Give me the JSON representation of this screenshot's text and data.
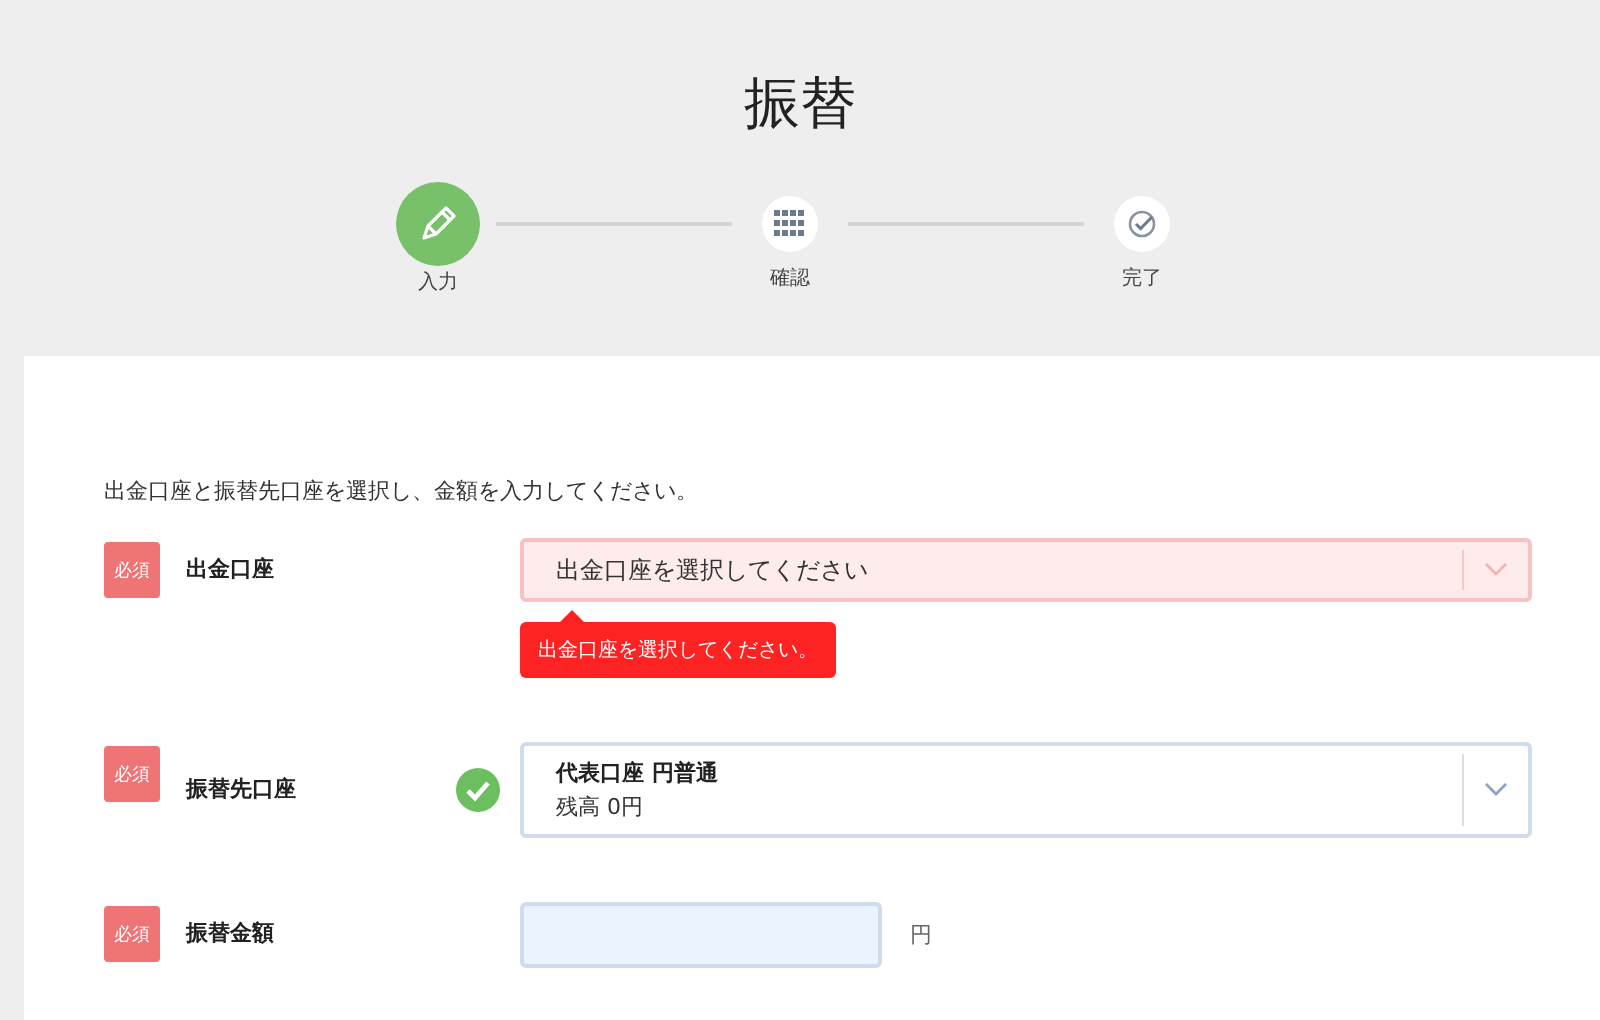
{
  "title": "振替",
  "steps": [
    {
      "label": "入力",
      "selected": true,
      "kind": "pencil"
    },
    {
      "label": "確認",
      "selected": false,
      "kind": "grid"
    },
    {
      "label": "完了",
      "selected": false,
      "kind": "check"
    }
  ],
  "instruction": "出金口座と振替先口座を選択し、金額を入力してください。",
  "fields": [
    {
      "kind": "select",
      "badge": "必須",
      "label": "出金口座",
      "valid": false,
      "error": true,
      "placeholder": "出金口座を選択してください",
      "error_message": "出金口座を選択してください。"
    },
    {
      "kind": "select",
      "badge": "必須",
      "label": "振替先口座",
      "valid": true,
      "error": false,
      "value": "代表口座 円普通",
      "detail": "残高 0円"
    },
    {
      "kind": "amount",
      "badge": "必須",
      "label": "振替金額",
      "unit": "円"
    }
  ]
}
